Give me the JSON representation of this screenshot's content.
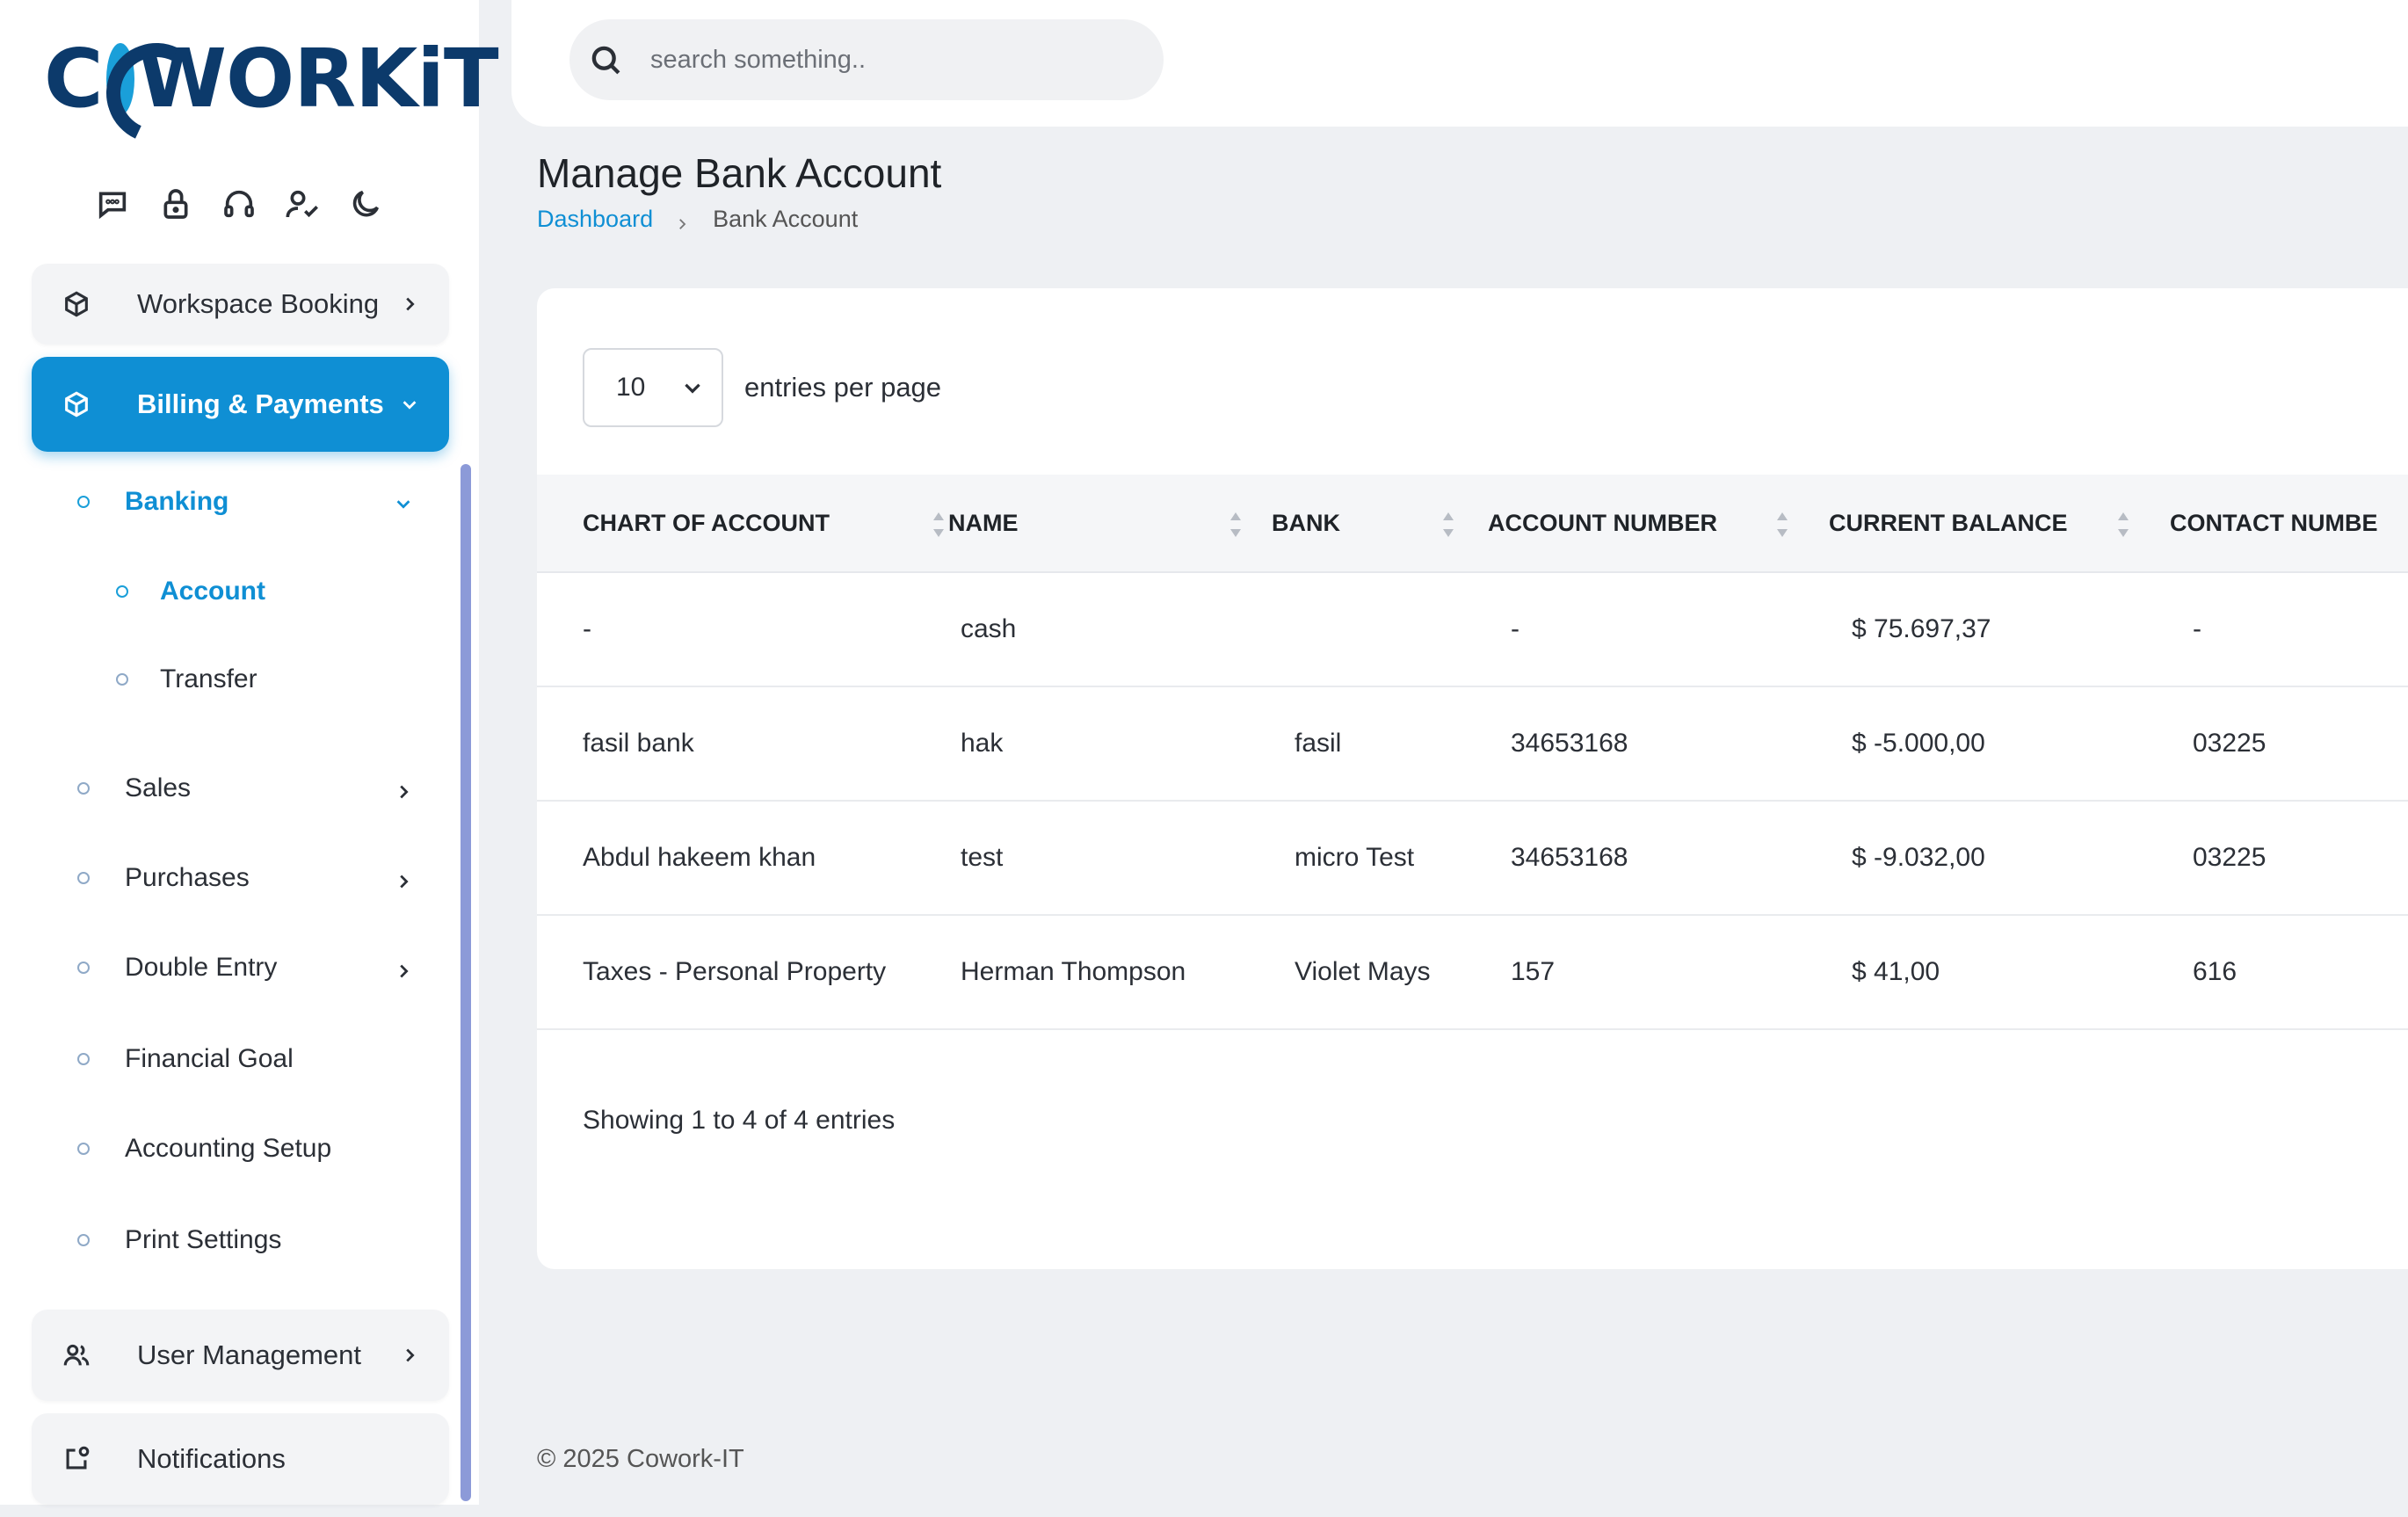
{
  "brand": {
    "logo_text": "COWORKiT",
    "primary_color": "#0f8fd4",
    "dark_color": "#0c3a6b"
  },
  "quick_icons": [
    "chat-icon",
    "lock-icon",
    "headset-icon",
    "user-check-icon",
    "moon-icon"
  ],
  "sidebar": {
    "workspace_booking": "Workspace Booking",
    "billing_payments": "Billing & Payments",
    "banking": "Banking",
    "account": "Account",
    "transfer": "Transfer",
    "sales": "Sales",
    "purchases": "Purchases",
    "double_entry": "Double Entry",
    "financial_goal": "Financial Goal",
    "accounting_setup": "Accounting Setup",
    "print_settings": "Print Settings",
    "user_management": "User Management",
    "notifications": "Notifications"
  },
  "search": {
    "placeholder": "search something.."
  },
  "page": {
    "title": "Manage Bank Account",
    "breadcrumb": {
      "home": "Dashboard",
      "current": "Bank Account"
    }
  },
  "table_controls": {
    "per_page_value": "10",
    "per_page_label": "entries per page"
  },
  "table": {
    "columns": [
      "CHART OF ACCOUNT",
      "NAME",
      "BANK",
      "ACCOUNT NUMBER",
      "CURRENT BALANCE",
      "CONTACT NUMBE"
    ],
    "rows": [
      [
        "-",
        "cash",
        "",
        "-",
        "$ 75.697,37",
        "-"
      ],
      [
        "fasil bank",
        "hak",
        "fasil",
        "34653168",
        "$ -5.000,00",
        "03225"
      ],
      [
        "Abdul hakeem khan",
        "test",
        "micro Test",
        "34653168",
        "$ -9.032,00",
        "03225"
      ],
      [
        "Taxes - Personal Property",
        "Herman Thompson",
        "Violet Mays",
        "157",
        "$ 41,00",
        "616"
      ]
    ]
  },
  "showing": "Showing 1 to 4 of 4 entries",
  "footer": "© 2025 Cowork-IT"
}
